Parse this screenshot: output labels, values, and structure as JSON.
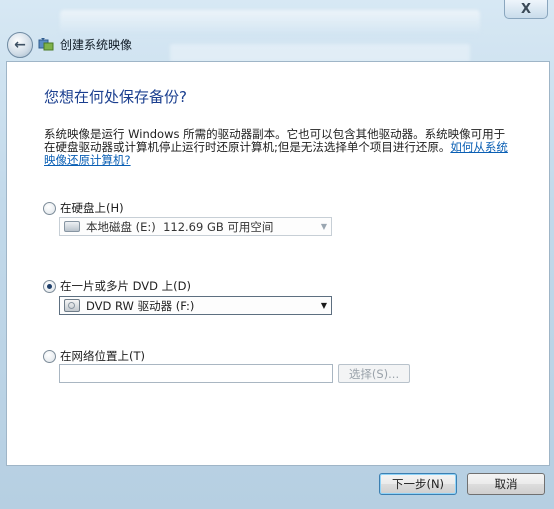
{
  "window": {
    "title": "创建系统映像",
    "close_label": "X"
  },
  "page": {
    "heading": "您想在何处保存备份?",
    "description": "系统映像是运行 Windows 所需的驱动器副本。它也可以包含其他驱动器。系统映像可用于在硬盘驱动器或计算机停止运行时还原计算机;但是无法选择单个项目进行还原。",
    "help_link": "如何从系统映像还原计算机?"
  },
  "options": {
    "hard_disk": {
      "label": "在硬盘上(H)",
      "selected": false,
      "drive_value": "本地磁盘 (E:)  112.69 GB 可用空间"
    },
    "dvd": {
      "label": "在一片或多片 DVD 上(D)",
      "selected": true,
      "drive_value": "DVD RW 驱动器 (F:)"
    },
    "network": {
      "label": "在网络位置上(T)",
      "selected": false,
      "path_value": "",
      "browse_label": "选择(S)..."
    }
  },
  "buttons": {
    "next": "下一步(N)",
    "cancel": "取消"
  },
  "icons": {
    "back": "back-arrow-icon",
    "app": "backup-app-icon",
    "hard_disk": "hard-drive-icon",
    "dvd": "dvd-drive-icon",
    "dropdown": "chevron-down-icon"
  }
}
